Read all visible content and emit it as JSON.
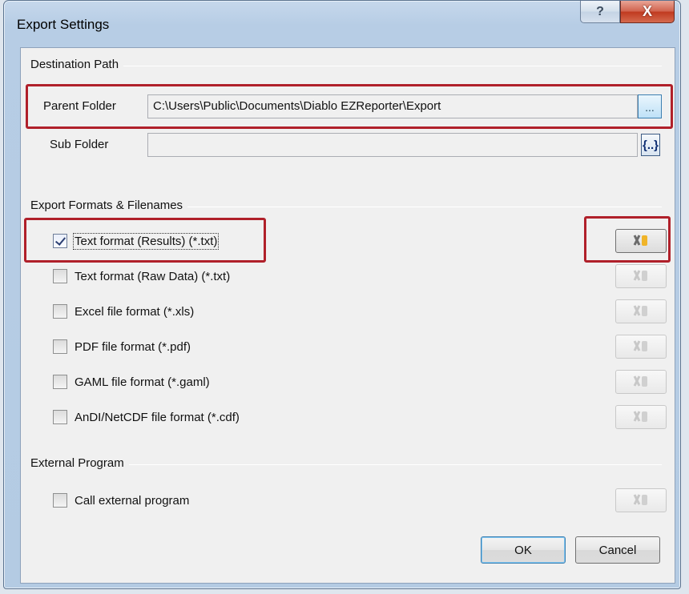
{
  "window": {
    "title": "Export Settings",
    "help_glyph": "?",
    "close_glyph": "X"
  },
  "destination": {
    "group_label": "Destination Path",
    "parent_folder_label": "Parent Folder",
    "parent_folder_value": "C:\\Users\\Public\\Documents\\Diablo EZReporter\\Export",
    "browse_label": "...",
    "sub_folder_label": "Sub Folder",
    "sub_folder_value": "",
    "macro_label": "{..}"
  },
  "formats": {
    "group_label": "Export Formats & Filenames",
    "items": [
      {
        "label": "Text format (Results) (*.txt)",
        "checked": true
      },
      {
        "label": "Text format (Raw Data) (*.txt)",
        "checked": false
      },
      {
        "label": "Excel file format (*.xls)",
        "checked": false
      },
      {
        "label": "PDF file format (*.pdf)",
        "checked": false
      },
      {
        "label": "GAML file format (*.gaml)",
        "checked": false
      },
      {
        "label": "AnDI/NetCDF file format (*.cdf)",
        "checked": false
      }
    ]
  },
  "external": {
    "group_label": "External Program",
    "call_label": "Call external program",
    "checked": false
  },
  "buttons": {
    "ok_label": "OK",
    "cancel_label": "Cancel"
  },
  "icons": {
    "settings_tool": "tools-icon",
    "checkmark": "check-icon"
  },
  "colors": {
    "highlight": "#b0202a",
    "close_button": "#c0391f",
    "dialog_background": "#f0f0f0"
  }
}
